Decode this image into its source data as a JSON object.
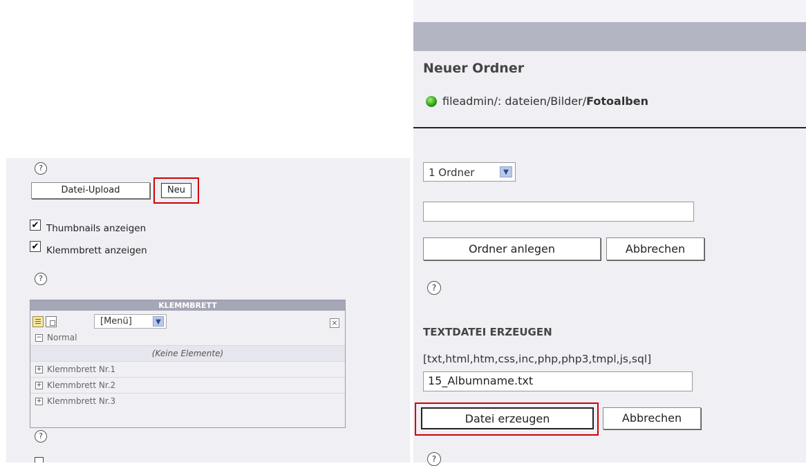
{
  "left": {
    "upload_button": "Datei-Upload",
    "new_button": "Neu",
    "help_glyph": "?",
    "show_thumbnails": {
      "label": "Thumbnails anzeigen",
      "checked": true,
      "glyph": "✔"
    },
    "show_clipboard": {
      "label": "Klemmbrett anzeigen",
      "checked": true,
      "glyph": "✔"
    },
    "clipboard": {
      "title": "KLEMMBRETT",
      "menu_value": "[Menü]",
      "close_glyph": "×",
      "rows": [
        {
          "toggle": "−",
          "label": "Normal"
        },
        {
          "toggle": "",
          "label": "(Keine Elemente)"
        },
        {
          "toggle": "+",
          "label": "Klemmbrett Nr.1"
        },
        {
          "toggle": "+",
          "label": "Klemmbrett Nr.2"
        },
        {
          "toggle": "+",
          "label": "Klemmbrett Nr.3"
        }
      ]
    },
    "highlight_color": "#d00000"
  },
  "right": {
    "title": "Neuer Ordner",
    "path_prefix": "fileadmin/: dateien/Bilder/",
    "path_bold": "Fotoalben",
    "folder_count": "1 Ordner",
    "folder_name_value": "",
    "create_folder_button": "Ordner anlegen",
    "cancel_folder_button": "Abbrechen",
    "textfile_heading": "TEXTDATEI ERZEUGEN",
    "allowed_extensions": "[txt,html,htm,css,inc,php,php3,tmpl,js,sql]",
    "filename_value": "15_Albumname.txt",
    "create_file_button": "Datei erzeugen",
    "cancel_file_button": "Abbrechen",
    "help_glyph": "?",
    "dropdown_glyph": "▼"
  }
}
